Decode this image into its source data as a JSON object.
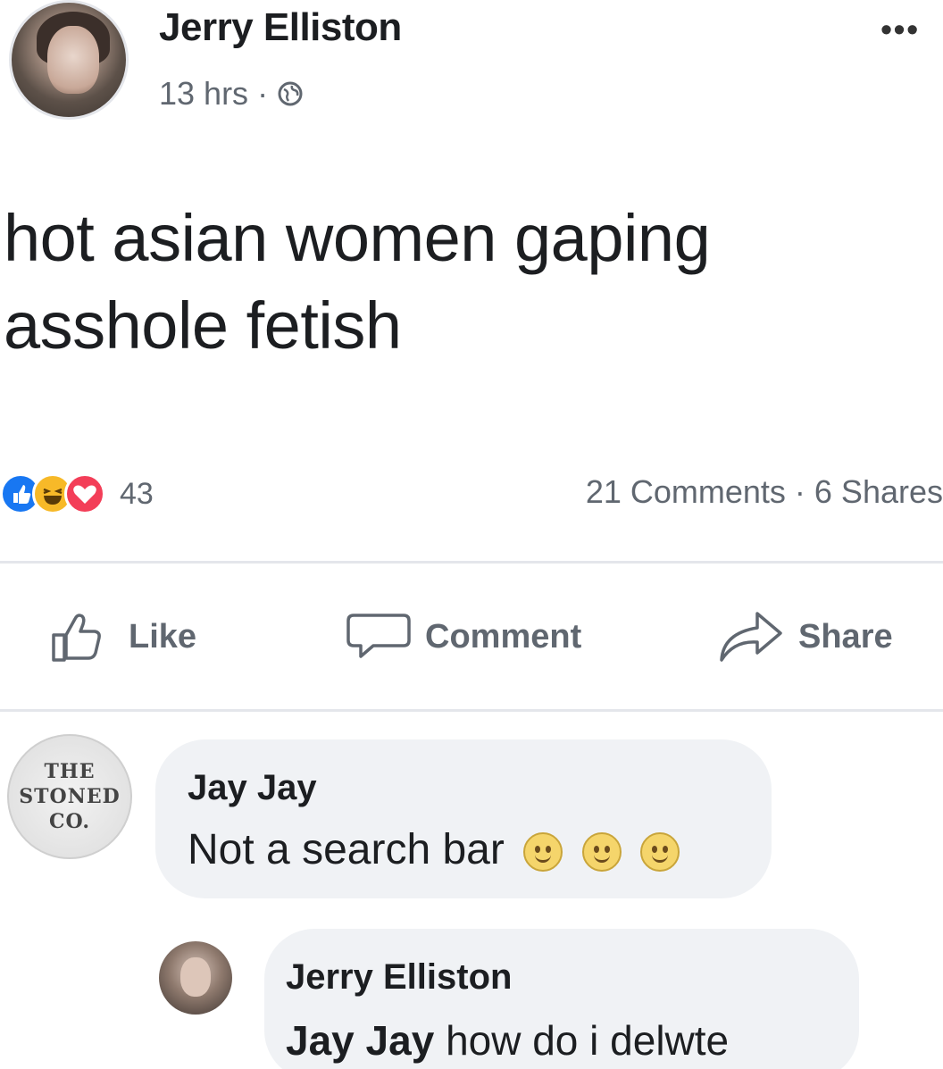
{
  "post": {
    "author": "Jerry Elliston",
    "time": "13 hrs",
    "separator": "·",
    "privacy_icon": "globe-icon",
    "more": "•••",
    "text": "hot asian women gaping asshole fetish",
    "reaction_icons": [
      "like-icon",
      "haha-icon",
      "love-icon"
    ],
    "reaction_count": "43",
    "counts_text": "21 Comments · 6 Shares"
  },
  "actions": {
    "like": "Like",
    "comment": "Comment",
    "share": "Share"
  },
  "comments": [
    {
      "author": "Jay Jay",
      "avatar_text": "THE STONED CO.",
      "text": "Not a search bar",
      "emojis": [
        "grinning-emoji",
        "grinning-emoji",
        "grinning-emoji"
      ]
    },
    {
      "author": "Jerry Elliston",
      "mention": "Jay Jay",
      "text": "how do i delwte"
    }
  ],
  "colors": {
    "text": "#1c1e21",
    "secondary": "#606770",
    "like_blue": "#1877f2",
    "haha_yellow": "#f7b928",
    "love_red": "#f33e58",
    "bubble": "#f0f2f5"
  }
}
